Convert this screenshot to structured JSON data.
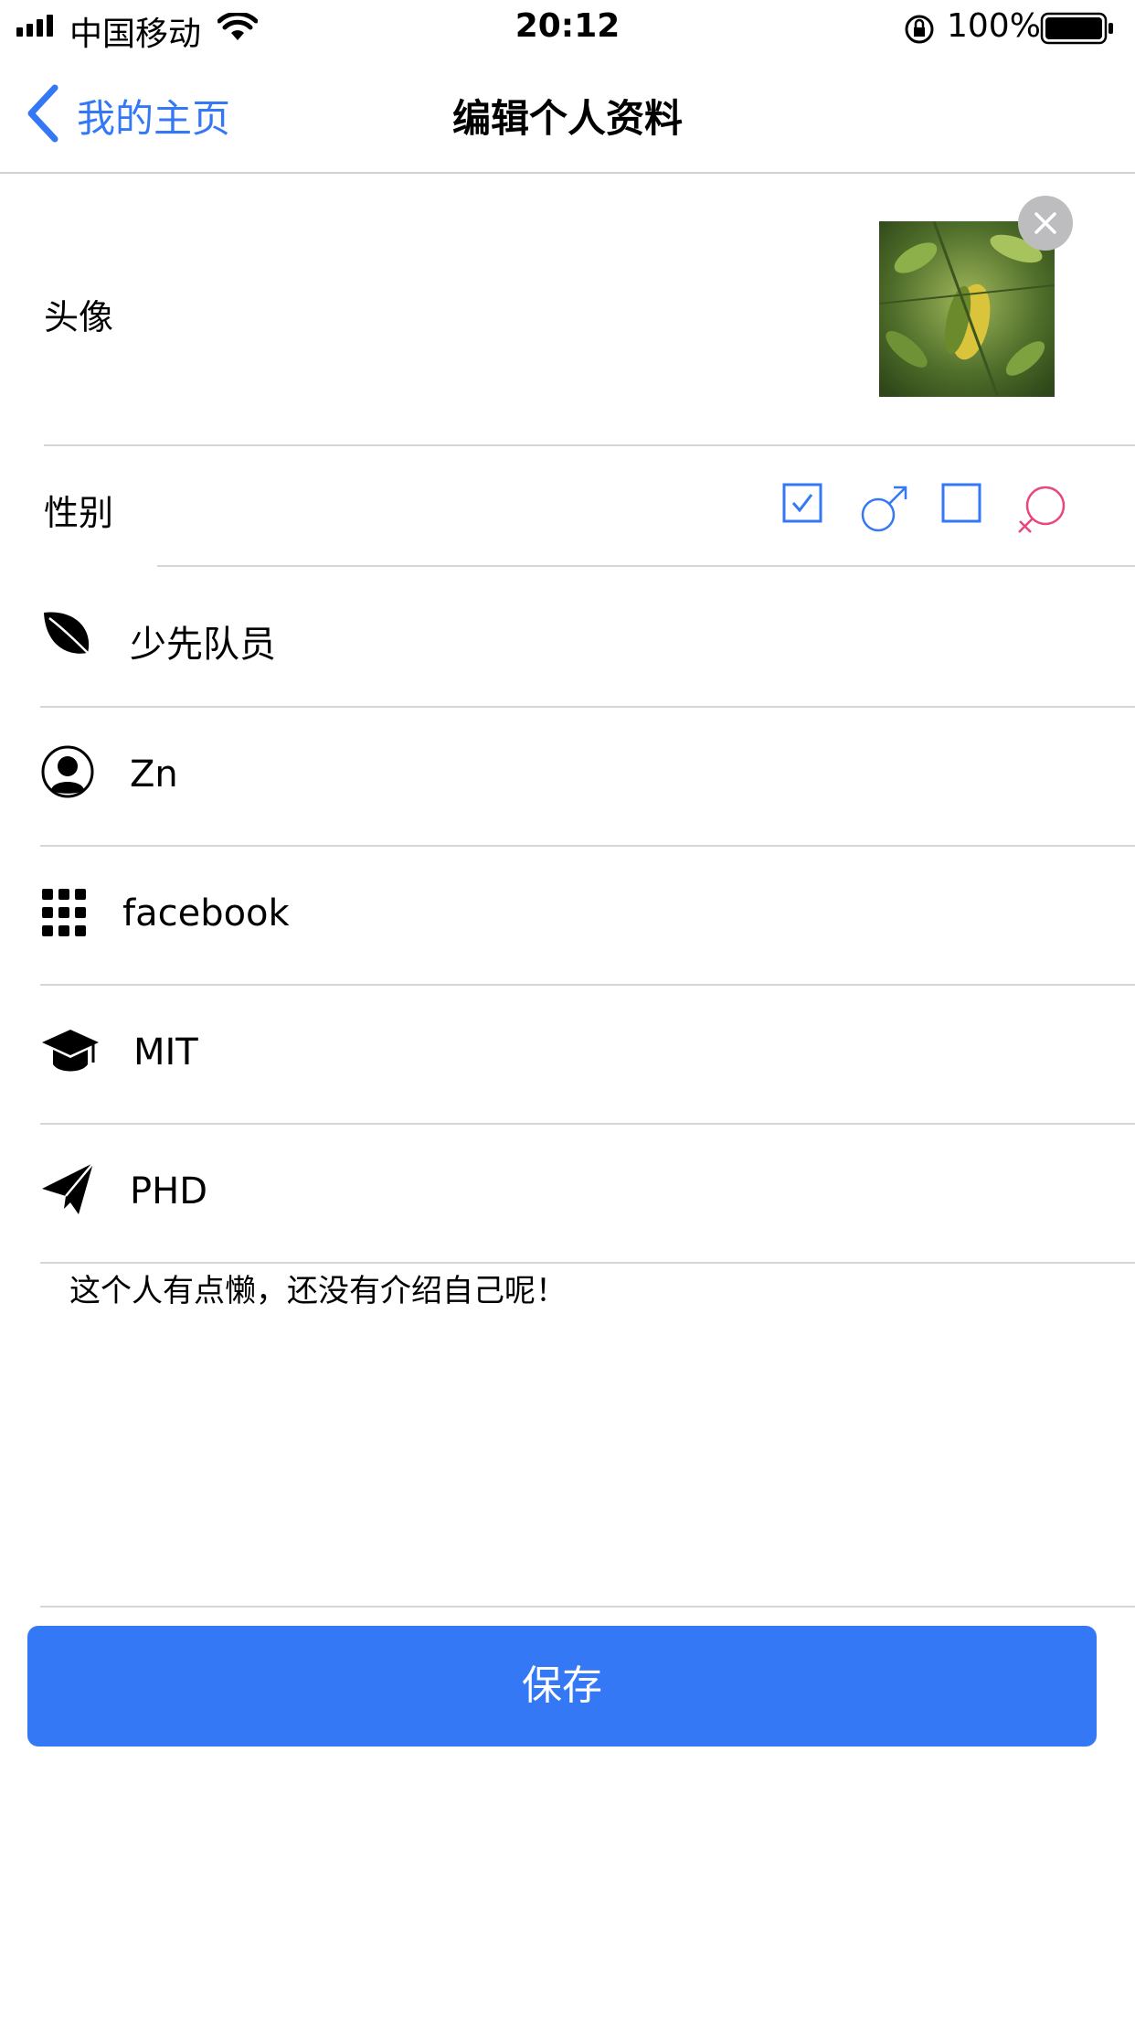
{
  "status_bar": {
    "carrier": "中国移动",
    "time": "20:12",
    "battery_percent": "100%"
  },
  "nav": {
    "back_label": "我的主页",
    "title": "编辑个人资料"
  },
  "form": {
    "avatar_label": "头像",
    "gender_label": "性别",
    "gender_selected": "male",
    "fields": [
      {
        "icon": "leaf-icon",
        "value": "少先队员"
      },
      {
        "icon": "user-circle-icon",
        "value": "Zn"
      },
      {
        "icon": "grid-apps-icon",
        "value": "facebook"
      },
      {
        "icon": "graduation-cap-icon",
        "value": "MIT"
      },
      {
        "icon": "paper-plane-icon",
        "value": "PHD"
      }
    ],
    "intro_text": "这个人有点懒，还没有介绍自己呢！"
  },
  "save_label": "保存",
  "colors": {
    "accent": "#3478f6",
    "female": "#e8467c"
  }
}
